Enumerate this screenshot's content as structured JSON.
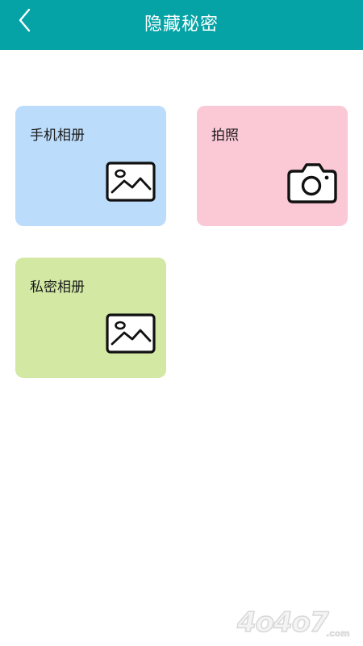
{
  "header": {
    "title": "隐藏秘密",
    "back_icon": "chevron-left-icon",
    "background": "#06a3a6"
  },
  "cards": [
    {
      "label": "手机相册",
      "icon": "image-icon",
      "color": "#bcdcfb"
    },
    {
      "label": "拍照",
      "icon": "camera-icon",
      "color": "#fbc8d6"
    },
    {
      "label": "私密相册",
      "icon": "image-icon",
      "color": "#d2e8a3"
    }
  ],
  "watermark": {
    "text": "4o4o7",
    "suffix": ".com"
  }
}
